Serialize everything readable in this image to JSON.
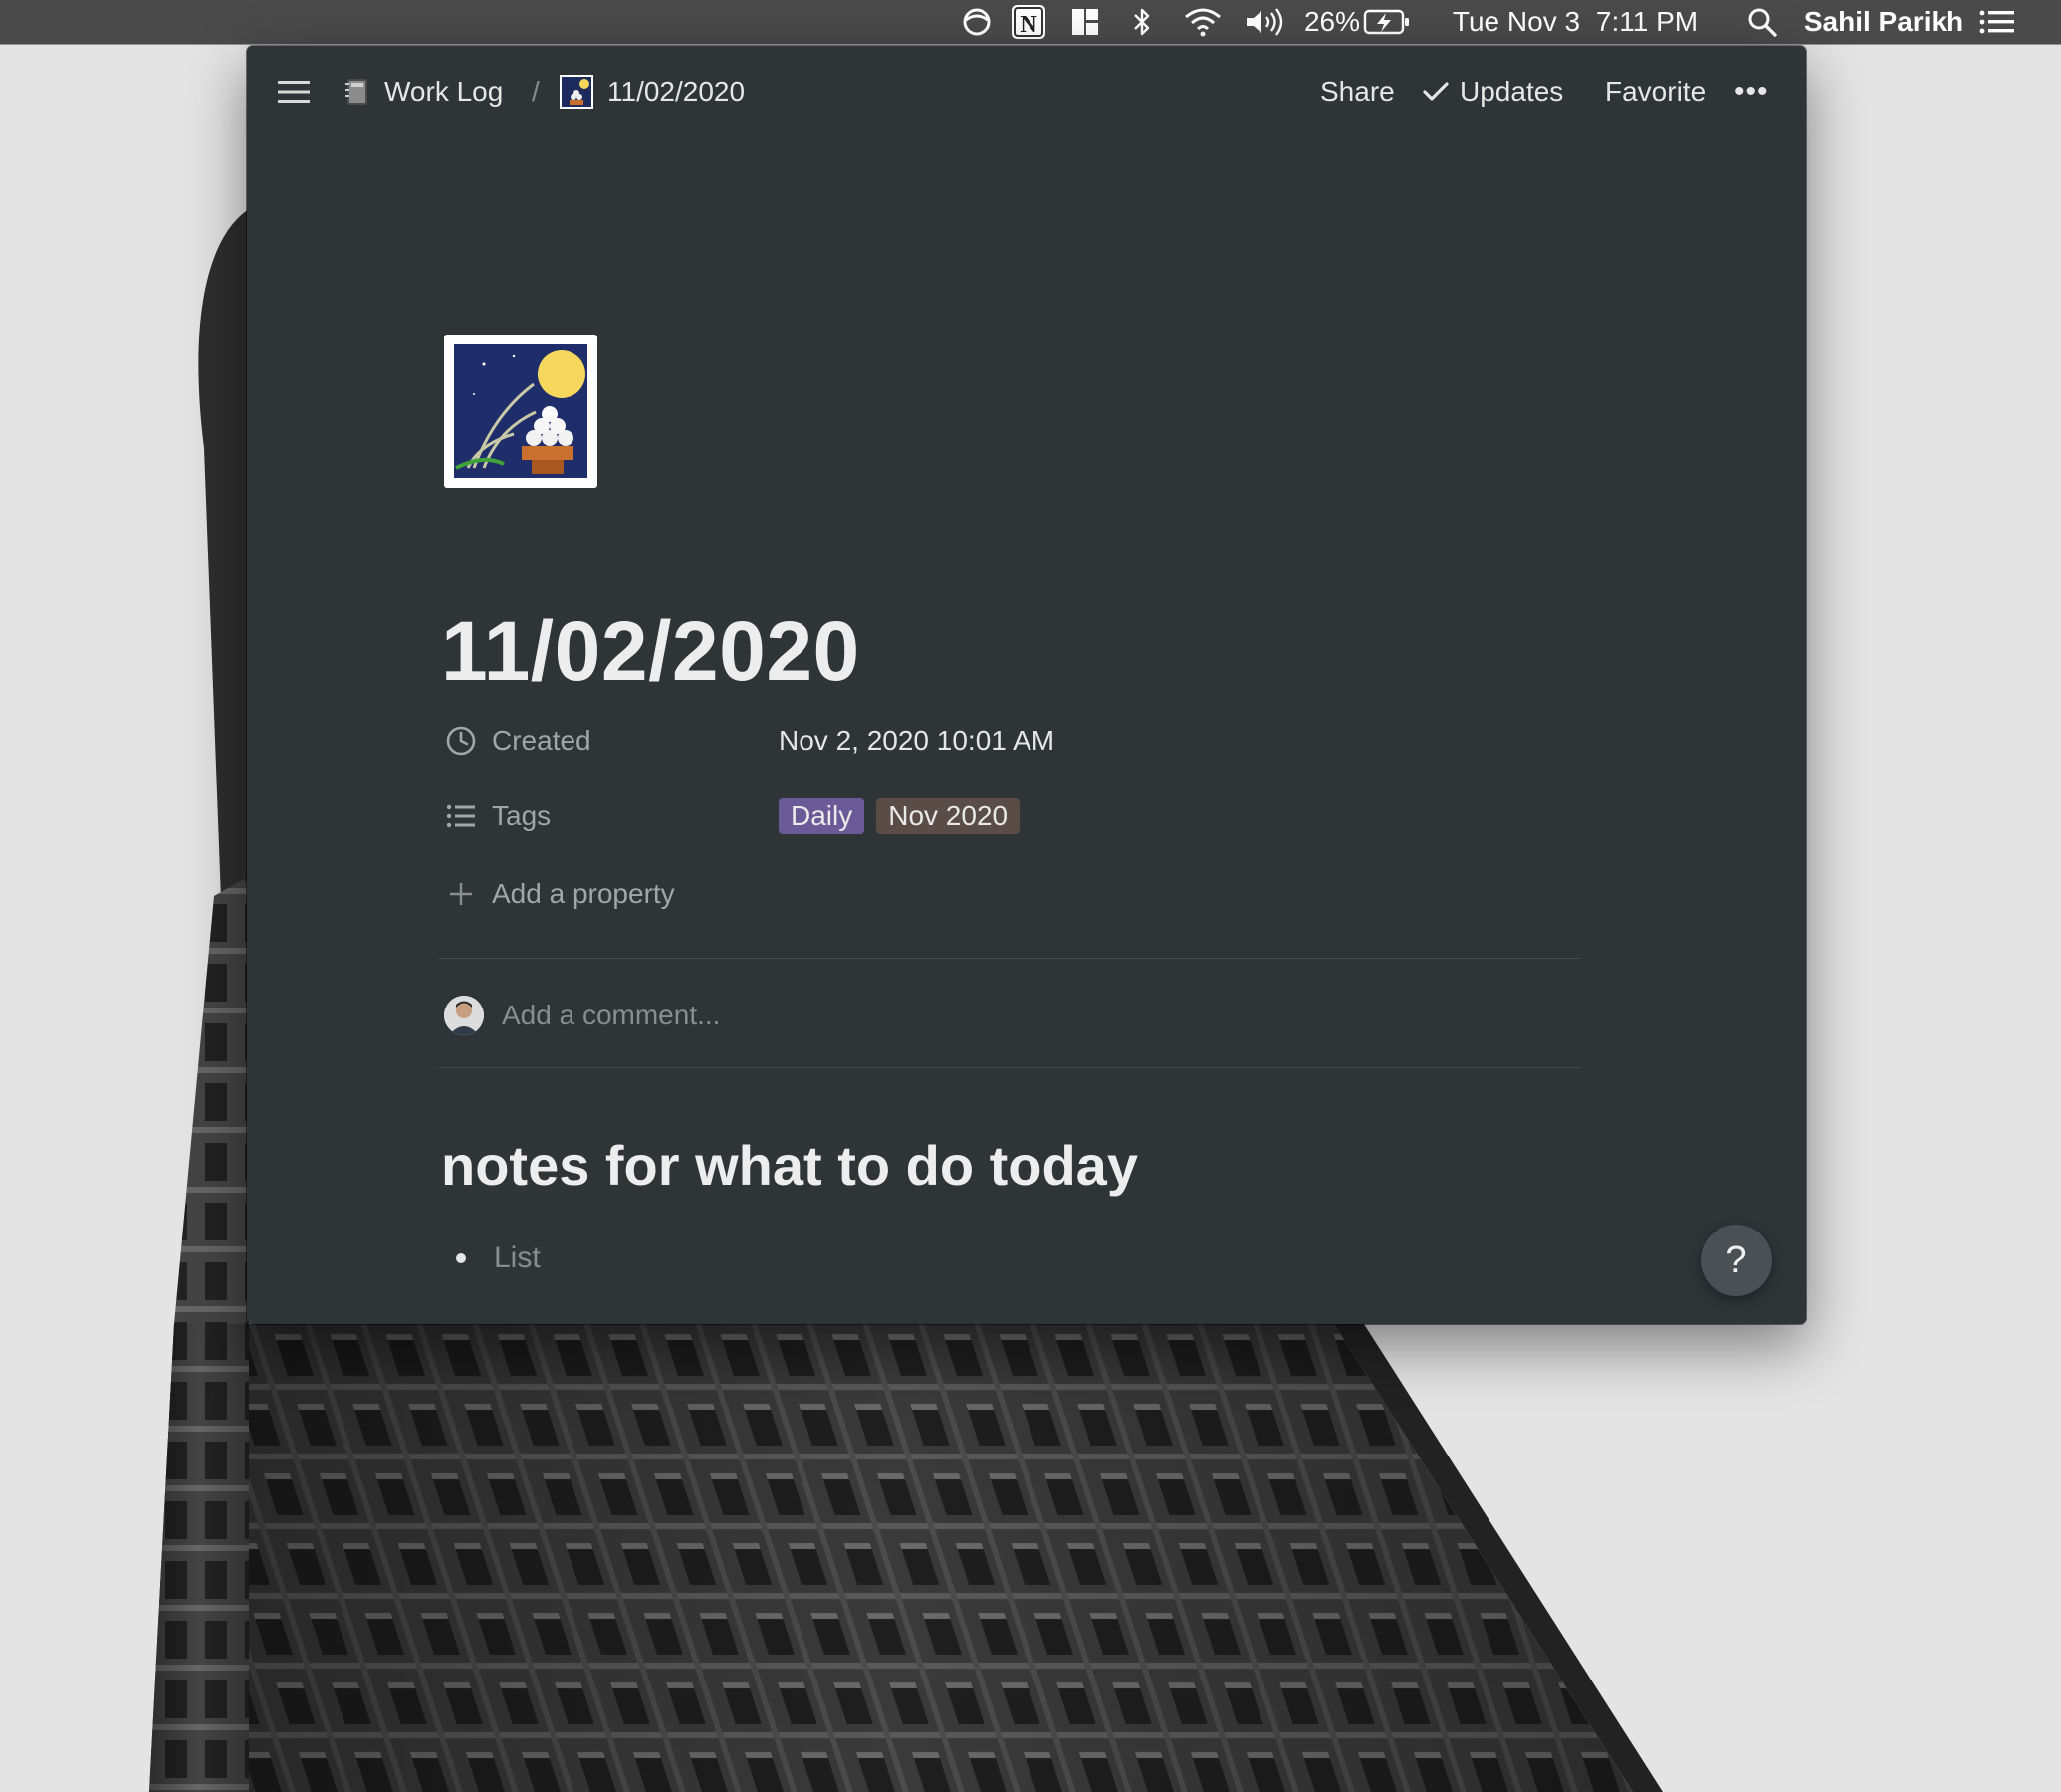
{
  "menubar": {
    "battery_percent": "26%",
    "date": "Tue Nov 3",
    "time": "7:11 PM",
    "user": "Sahil Parikh",
    "icons": [
      "focus-icon",
      "notion-app-icon",
      "layout-icon",
      "bluetooth-icon",
      "wifi-icon",
      "volume-icon",
      "battery-charging-icon",
      "spotlight-search-icon",
      "control-list-icon"
    ]
  },
  "topbar": {
    "parent_page": "Work Log",
    "separator": "/",
    "current_page": "11/02/2020",
    "share": "Share",
    "updates": "Updates",
    "favorite": "Favorite",
    "more": "•••"
  },
  "page": {
    "title": "11/02/2020",
    "icon": "moon-viewing-ceremony-emoji",
    "properties": [
      {
        "name": "Created",
        "icon": "clock-icon",
        "value": "Nov 2, 2020 10:01 AM"
      },
      {
        "name": "Tags",
        "icon": "list-icon",
        "tags": [
          {
            "label": "Daily",
            "color": "#6b5a98"
          },
          {
            "label": "Nov 2020",
            "color": "#5a4d48"
          }
        ]
      }
    ],
    "add_property": "Add a property",
    "comment_placeholder": "Add a comment...",
    "heading": "notes for what to do today",
    "list_items": [
      "List"
    ]
  },
  "help": "?",
  "colors": {
    "window_bg": "#2f3437",
    "menubar_bg": "#4a4a4a",
    "desktop_bg": "#e4e4e4"
  }
}
